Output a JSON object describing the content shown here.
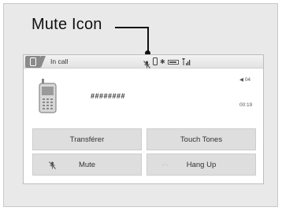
{
  "callout": {
    "label": "Mute Icon"
  },
  "screen": {
    "title": "In call",
    "number": "########",
    "volume": "04",
    "volume_icon": "speaker-icon",
    "timer": "00:19",
    "status_icons": [
      "mic-muted-icon",
      "phone-icon",
      "bluetooth-icon",
      "battery-icon",
      "signal-icon"
    ],
    "colors": {
      "panel": "#e9e9e9",
      "button": "#dedede",
      "text": "#333333"
    }
  },
  "buttons": {
    "transfer": "Transférer",
    "touch_tones": "Touch Tones",
    "mute": "Mute",
    "hang_up": "Hang Up"
  }
}
